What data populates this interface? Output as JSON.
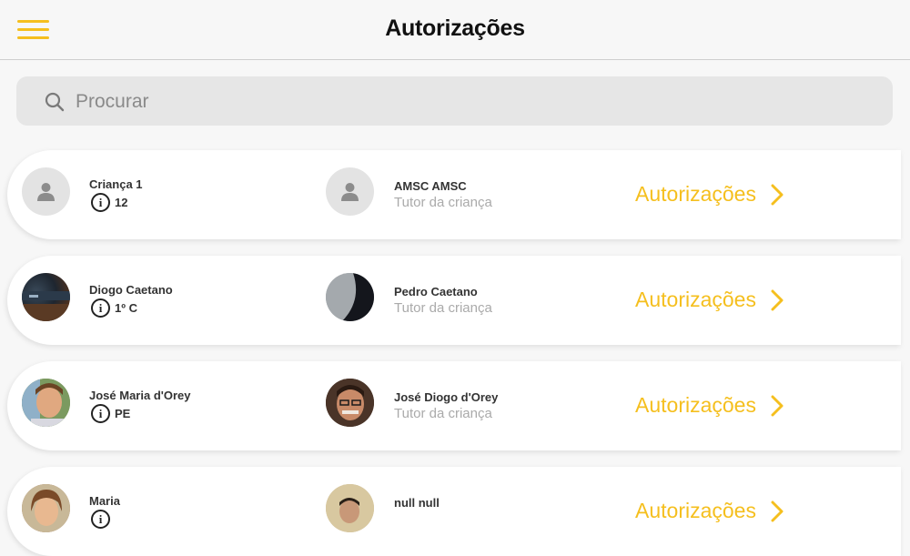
{
  "header": {
    "title": "Autorizações"
  },
  "search": {
    "placeholder": "Procurar"
  },
  "colors": {
    "accent": "#f5bf1e",
    "background": "#f7f7f7",
    "card": "#ffffff"
  },
  "rows": [
    {
      "child_name": "Criança 1",
      "child_class": "12",
      "child_avatar": "default-user-icon",
      "tutor_name": "AMSC AMSC",
      "tutor_role": "Tutor da criança",
      "tutor_avatar": "default-user-icon",
      "link_label": "Autorizações"
    },
    {
      "child_name": "Diogo Caetano",
      "child_class": "1º C",
      "child_avatar": "photo",
      "tutor_name": "Pedro Caetano",
      "tutor_role": "Tutor da criança",
      "tutor_avatar": "photo",
      "link_label": "Autorizações"
    },
    {
      "child_name": "José Maria d'Orey",
      "child_class": "PE",
      "child_avatar": "photo",
      "tutor_name": "José Diogo d'Orey",
      "tutor_role": "Tutor da criança",
      "tutor_avatar": "photo",
      "link_label": "Autorizações"
    },
    {
      "child_name": "Maria",
      "child_avatar": "photo",
      "tutor_name": "null null",
      "tutor_avatar": "photo",
      "link_label": "Autorizações"
    }
  ]
}
